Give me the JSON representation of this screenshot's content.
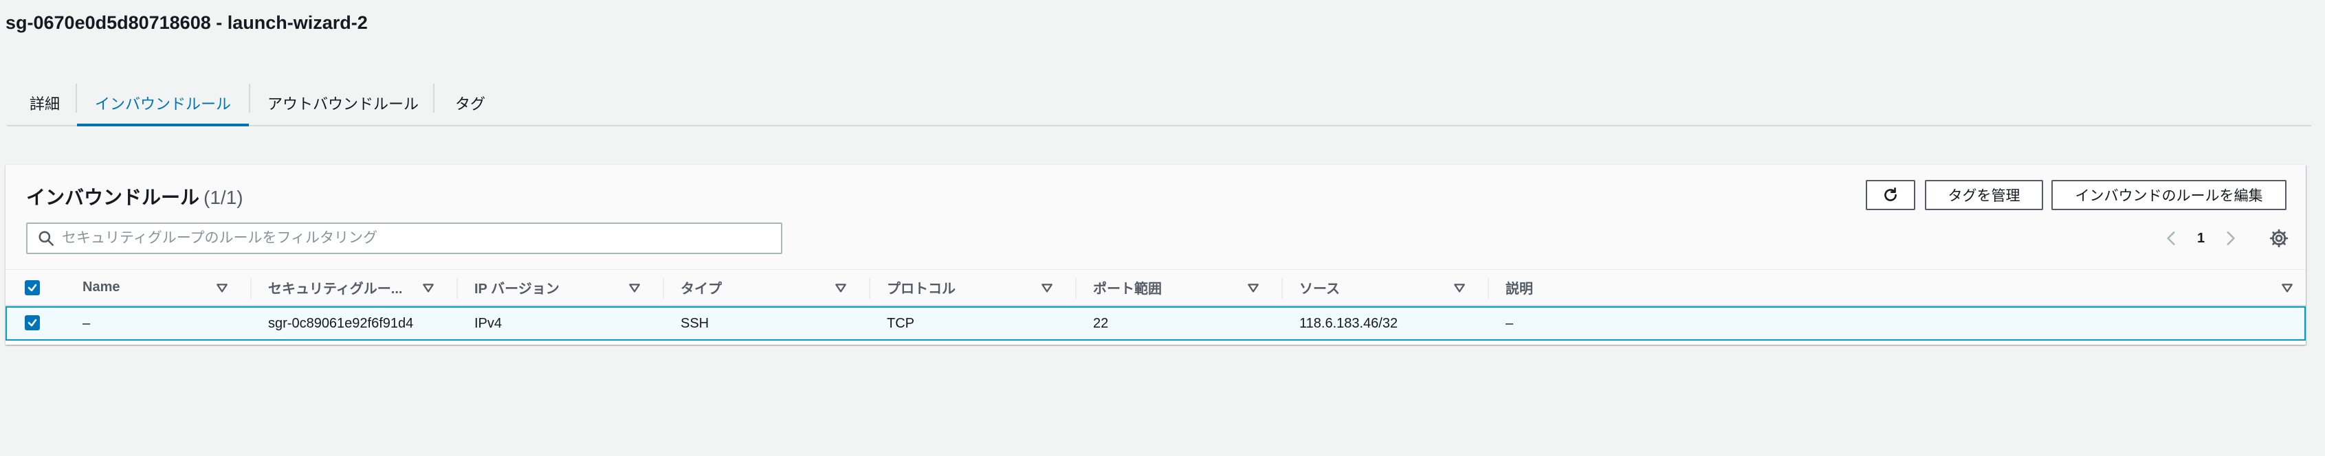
{
  "page": {
    "title": "sg-0670e0d5d80718608 - launch-wizard-2"
  },
  "tabs": [
    {
      "label": "詳細"
    },
    {
      "label": "インバウンドルール"
    },
    {
      "label": "アウトバウンドルール"
    },
    {
      "label": "タグ"
    }
  ],
  "panel": {
    "title": "インバウンドルール",
    "count": "(1/1)",
    "manage_tags_label": "タグを管理",
    "edit_rules_label": "インバウンドのルールを編集",
    "search_placeholder": "セキュリティグループのルールをフィルタリング",
    "current_page": "1"
  },
  "table": {
    "columns": [
      "Name",
      "セキュリティグルー...",
      "IP バージョン",
      "タイプ",
      "プロトコル",
      "ポート範囲",
      "ソース",
      "説明"
    ],
    "rows": [
      {
        "name": "–",
        "rule_id": "sgr-0c89061e92f6f91d4",
        "ip_version": "IPv4",
        "type": "SSH",
        "protocol": "TCP",
        "port_range": "22",
        "source": "118.6.183.46/32",
        "description": "–"
      }
    ]
  },
  "colors": {
    "accent": "#0073bb",
    "selected_row_border": "#00a1c9",
    "selected_row_bg": "#f1faff"
  }
}
